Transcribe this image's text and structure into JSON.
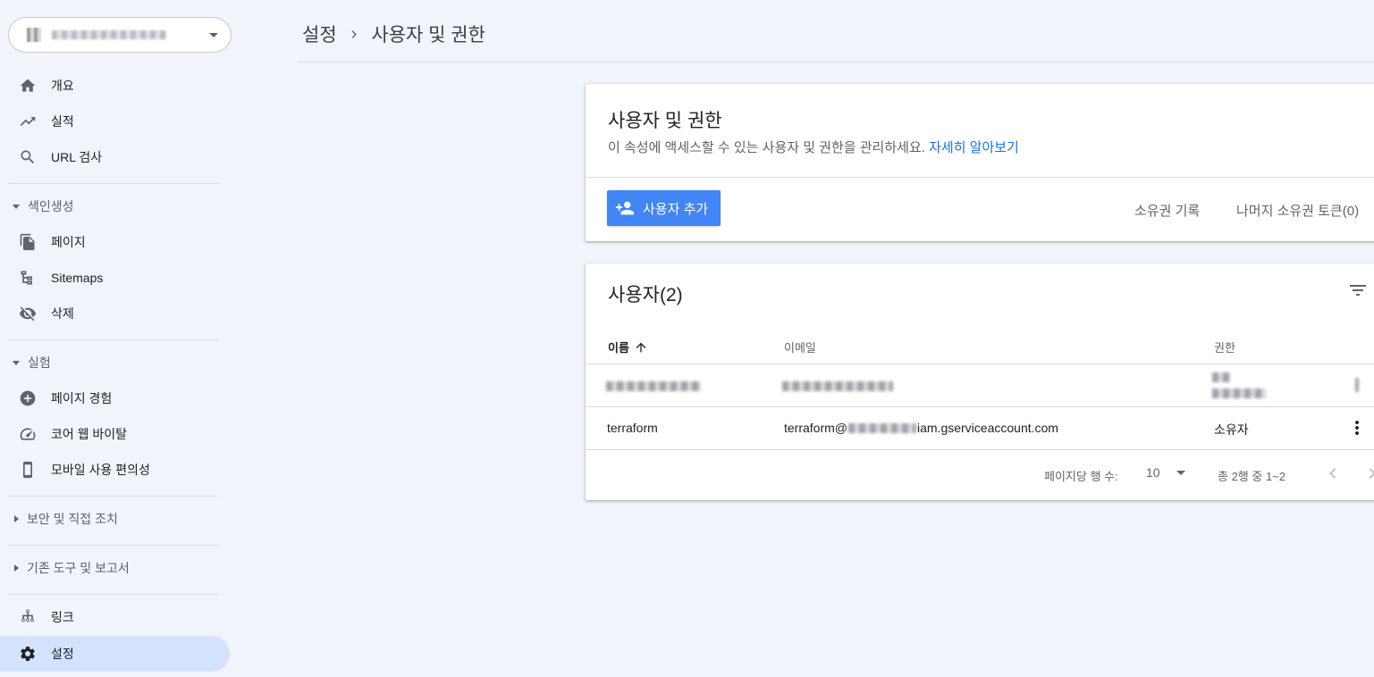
{
  "breadcrumb": {
    "parent": "설정",
    "separator": "›",
    "current": "사용자 및 권한"
  },
  "sidebar": {
    "top_items": [
      {
        "label": "개요",
        "icon": "home-icon"
      },
      {
        "label": "실적",
        "icon": "trending-up-icon"
      },
      {
        "label": "URL 검사",
        "icon": "search-icon"
      }
    ],
    "indexing": {
      "title": "색인생성",
      "items": [
        {
          "label": "페이지",
          "icon": "pages-icon"
        },
        {
          "label": "Sitemaps",
          "icon": "sitemap-icon"
        },
        {
          "label": "삭제",
          "icon": "visibility-off-icon"
        }
      ]
    },
    "experience": {
      "title": "실험",
      "items": [
        {
          "label": "페이지 경험",
          "icon": "add-circle-icon"
        },
        {
          "label": "코어 웹 바이탈",
          "icon": "speed-icon"
        },
        {
          "label": "모바일 사용 편의성",
          "icon": "smartphone-icon"
        }
      ]
    },
    "security": {
      "title": "보안 및 직접 조치"
    },
    "legacy": {
      "title": "기존 도구 및 보고서"
    },
    "bottom_items": [
      {
        "label": "링크",
        "icon": "links-icon"
      },
      {
        "label": "설정",
        "icon": "gear-icon",
        "active": true
      }
    ]
  },
  "permissions_card": {
    "title": "사용자 및 권한",
    "subtitle": "이 속성에 액세스할 수 있는 사용자 및 권한을 관리하세요.",
    "learn_more": "자세히 알아보기",
    "add_user_label": "사용자 추가",
    "ownership_history": "소유권 기록",
    "unused_tokens": "나머지 소유권 토큰(0)"
  },
  "users_card": {
    "title": "사용자(2)",
    "columns": {
      "name": "이름",
      "email": "이메일",
      "permission": "권한"
    },
    "rows": [
      {
        "name": "",
        "email": "",
        "permission": "",
        "redacted": true
      },
      {
        "name": "terraform",
        "email_prefix": "terraform@",
        "email_suffix": "iam.gserviceaccount.com",
        "permission": "소유자"
      }
    ],
    "footer": {
      "rows_per_page_label": "페이지당 행 수:",
      "rows_per_page": "10",
      "range": "총 2행 중 1~2"
    }
  },
  "colors": {
    "accent": "#4285f4",
    "link": "#1a73e8",
    "active_nav": "#d3e3fd",
    "background": "#f1f4fb"
  }
}
